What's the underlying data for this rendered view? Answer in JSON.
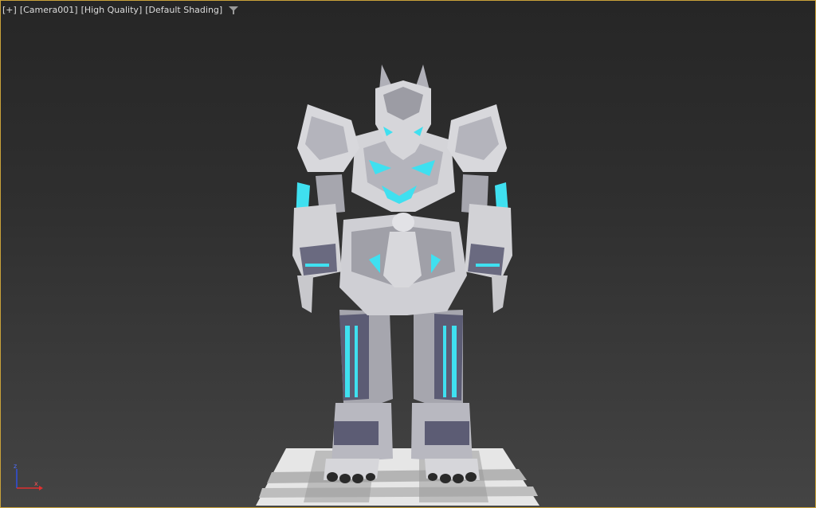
{
  "viewport": {
    "label_plus": "[+]",
    "label_camera": "[Camera001]",
    "label_quality": "[High Quality]",
    "label_shading": "[Default Shading]",
    "filter_icon": "filter-funnel-icon"
  },
  "axis_gizmo": {
    "z_label": "z",
    "x_label": "x",
    "colors": {
      "x": "#e03030",
      "z": "#3050e0"
    }
  },
  "colors": {
    "accent_glow": "#3fe0f0",
    "armor_light": "#d8d8dc",
    "armor_mid": "#a8a8b0",
    "armor_dark": "#5a5a70",
    "frame_border": "#c9a23a"
  }
}
